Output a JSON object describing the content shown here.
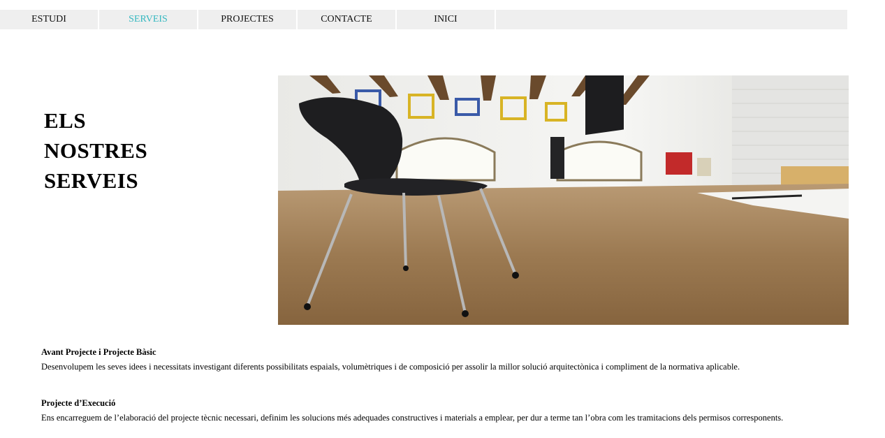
{
  "nav": {
    "items": [
      {
        "label": "ESTUDI",
        "active": false
      },
      {
        "label": "SERVEIS",
        "active": true
      },
      {
        "label": "PROJECTES",
        "active": false
      },
      {
        "label": "CONTACTE",
        "active": false
      },
      {
        "label": "INICI",
        "active": false
      }
    ],
    "active_color": "#35b8c0",
    "bar_color": "#efefef"
  },
  "title": {
    "lines": [
      "ELS",
      "NOSTRES",
      "SERVEIS"
    ]
  },
  "hero": {
    "icon": "office-photo"
  },
  "services": [
    {
      "heading": "Avant Projecte i Projecte Bàsic",
      "text": "Desenvolupem les seves idees i necessitats investigant diferents possibilitats espaials, volumètriques i de composició per assolir la millor solució arquitectònica i compliment de la normativa aplicable."
    },
    {
      "heading": "Projecte d’Execució",
      "text": "Ens encarreguem de l’elaboració del projecte tècnic necessari, definim les solucions més adequades constructives i materials a emplear, per dur a terme tan l’obra com les tramitacions dels permisos corresponents."
    }
  ]
}
